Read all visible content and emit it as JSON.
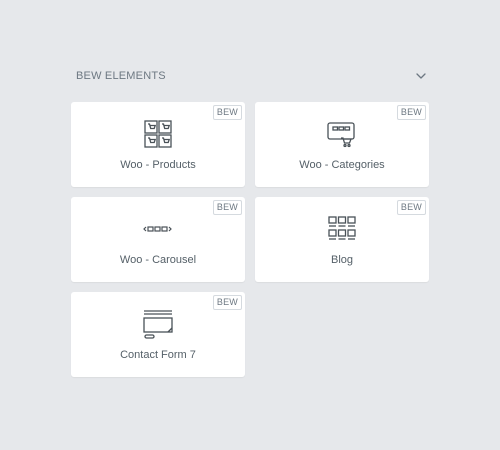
{
  "panel": {
    "title": "BEW ELEMENTS",
    "toggle_icon": "chevron-down-icon"
  },
  "widgets": [
    {
      "label": "Woo - Products",
      "badge": "BEW",
      "icon": "products-grid-icon"
    },
    {
      "label": "Woo - Categories",
      "badge": "BEW",
      "icon": "categories-icon"
    },
    {
      "label": "Woo - Carousel",
      "badge": "BEW",
      "icon": "carousel-icon"
    },
    {
      "label": "Blog",
      "badge": "BEW",
      "icon": "blog-grid-icon"
    },
    {
      "label": "Contact Form 7",
      "badge": "BEW",
      "icon": "contact-form-icon"
    }
  ],
  "colors": {
    "background": "#e6e8eb",
    "card": "#ffffff",
    "text": "#556068",
    "muted": "#6d7882"
  }
}
